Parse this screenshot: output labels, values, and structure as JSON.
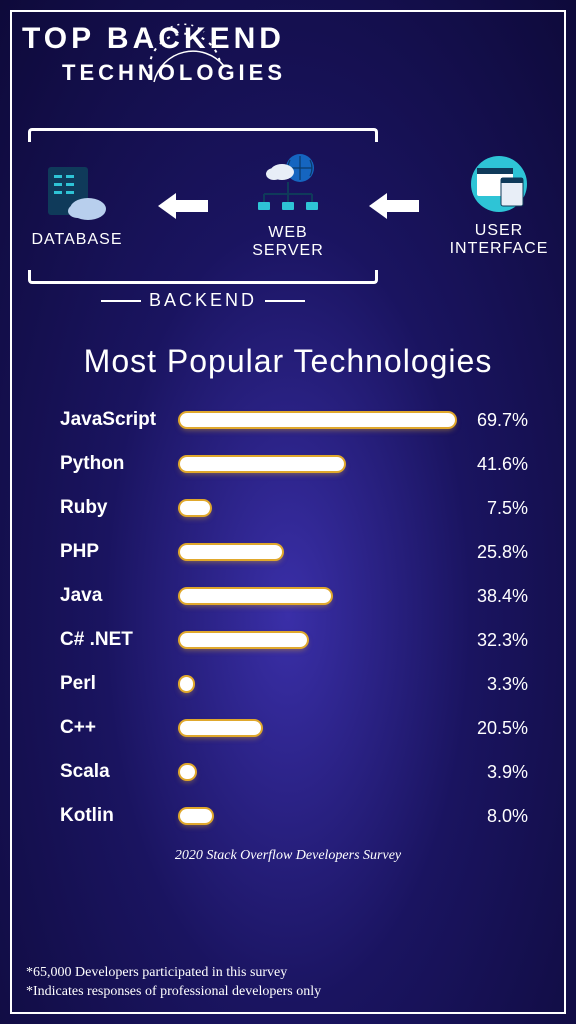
{
  "header": {
    "line1": "TOP BACKEND",
    "line2": "TECHNOLOGIES"
  },
  "flow": {
    "database": "DATABASE",
    "webserver": "WEB SERVER",
    "ui": "USER INTERFACE",
    "backend_label": "BACKEND"
  },
  "chart_title": "Most Popular Technologies",
  "chart_data": {
    "type": "bar",
    "title": "Most Popular Technologies",
    "xlabel": "",
    "ylabel": "",
    "ylim": [
      0,
      70
    ],
    "categories": [
      "JavaScript",
      "Python",
      "Ruby",
      "PHP",
      "Java",
      "C# .NET",
      "Perl",
      "C++",
      "Scala",
      "Kotlin"
    ],
    "values": [
      69.7,
      41.6,
      7.5,
      25.8,
      38.4,
      32.3,
      3.3,
      20.5,
      3.9,
      8.0
    ],
    "value_labels": [
      "69.7%",
      "41.6%",
      "7.5%",
      "25.8%",
      "38.4%",
      "32.3%",
      "3.3%",
      "20.5%",
      "3.9%",
      "8.0%"
    ]
  },
  "source": "2020 Stack Overflow Developers Survey",
  "footnotes": [
    "*65,000 Developers participated in this survey",
    "*Indicates responses of professional developers only"
  ]
}
